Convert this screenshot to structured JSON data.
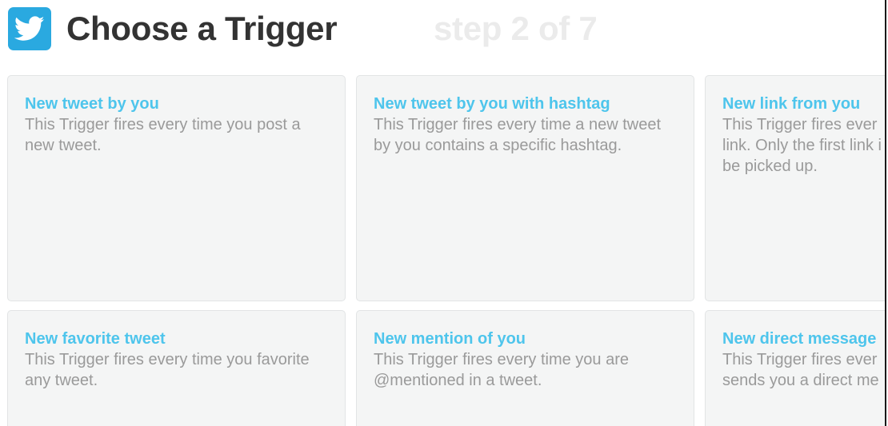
{
  "header": {
    "logo_icon": "twitter-bird-icon",
    "title": "Choose a Trigger",
    "step": "step 2 of 7"
  },
  "colors": {
    "brand": "#2aa9e0",
    "trigger_title": "#4ec5ec",
    "description": "#9a9a9a",
    "card_background": "#f4f5f5",
    "step_text": "#ebebeb"
  },
  "triggers": [
    {
      "title": "New tweet by you",
      "description_lines": [
        "This Trigger fires every time you post a",
        "new tweet."
      ]
    },
    {
      "title": "New tweet by you with hashtag",
      "description_lines": [
        "This Trigger fires every time a new tweet",
        "by you contains a specific hashtag."
      ]
    },
    {
      "title": "New link from you",
      "description_lines": [
        "This Trigger fires ever",
        "link. Only the first link i",
        "be picked up."
      ]
    },
    {
      "title": "New favorite tweet",
      "description_lines": [
        "This Trigger fires every time you favorite",
        "any tweet."
      ]
    },
    {
      "title": "New mention of you",
      "description_lines": [
        "This Trigger fires every time you are",
        "@mentioned in a tweet."
      ]
    },
    {
      "title": "New direct message",
      "description_lines": [
        "This Trigger fires ever",
        "sends you a direct me"
      ]
    }
  ]
}
